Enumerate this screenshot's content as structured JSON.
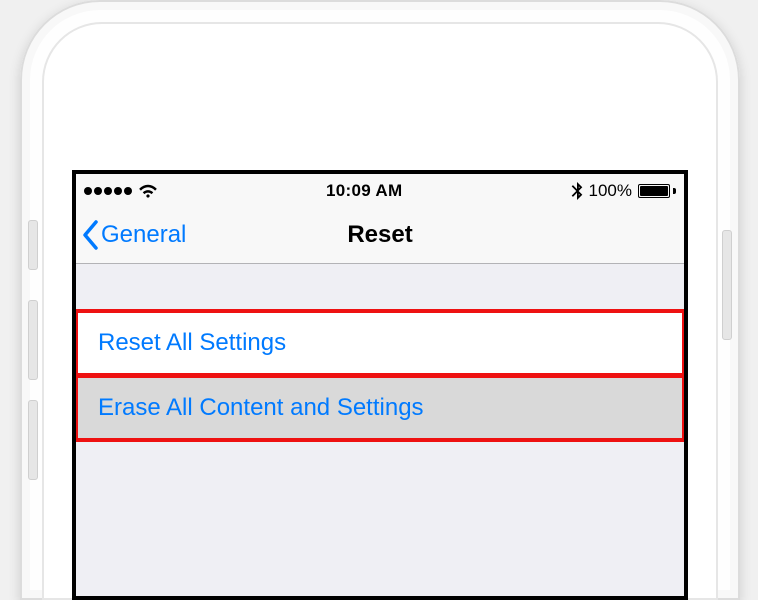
{
  "statusBar": {
    "time": "10:09 AM",
    "batteryPct": "100%"
  },
  "nav": {
    "backLabel": "General",
    "title": "Reset"
  },
  "options": {
    "resetAll": "Reset All Settings",
    "eraseAll": "Erase All Content and Settings"
  }
}
